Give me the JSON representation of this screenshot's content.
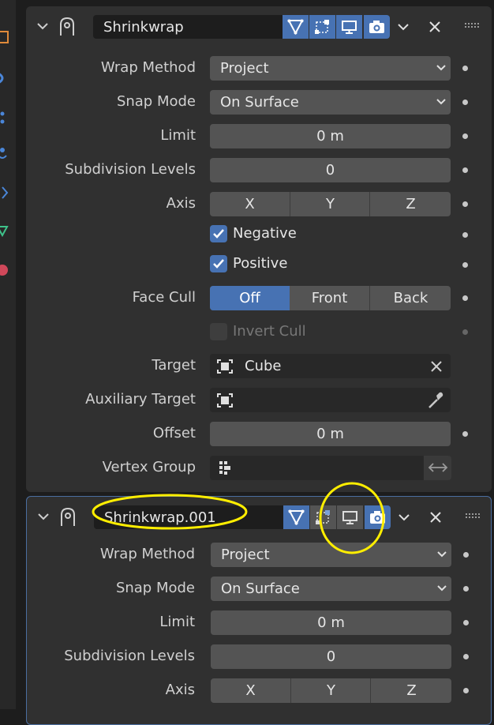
{
  "modifiers": [
    {
      "name": "Shrinkwrap",
      "toggles": [
        "edit-mode",
        "cage",
        "viewport",
        "render"
      ],
      "toggle_states": [
        true,
        true,
        true,
        true
      ],
      "props": {
        "wrap_method_label": "Wrap Method",
        "wrap_method_value": "Project",
        "snap_mode_label": "Snap Mode",
        "snap_mode_value": "On Surface",
        "limit_label": "Limit",
        "limit_value": "0 m",
        "subdiv_label": "Subdivision Levels",
        "subdiv_value": "0",
        "axis_label": "Axis",
        "axis_x": "X",
        "axis_y": "Y",
        "axis_z": "Z",
        "negative_label": "Negative",
        "positive_label": "Positive",
        "face_cull_label": "Face Cull",
        "cull_off": "Off",
        "cull_front": "Front",
        "cull_back": "Back",
        "invert_cull_label": "Invert Cull",
        "target_label": "Target",
        "target_value": "Cube",
        "aux_target_label": "Auxiliary Target",
        "aux_target_value": "",
        "offset_label": "Offset",
        "offset_value": "0 m",
        "vertex_group_label": "Vertex Group",
        "vertex_group_value": ""
      }
    },
    {
      "name": "Shrinkwrap.001",
      "toggles": [
        "edit-mode",
        "cage",
        "viewport",
        "render"
      ],
      "toggle_states": [
        true,
        false,
        false,
        true
      ],
      "props": {
        "wrap_method_label": "Wrap Method",
        "wrap_method_value": "Project",
        "snap_mode_label": "Snap Mode",
        "snap_mode_value": "On Surface",
        "limit_label": "Limit",
        "limit_value": "0 m",
        "subdiv_label": "Subdivision Levels",
        "subdiv_value": "0",
        "axis_label": "Axis",
        "axis_x": "X",
        "axis_y": "Y",
        "axis_z": "Z"
      }
    }
  ],
  "colors": {
    "accent": "#4772b3",
    "panel": "#303030",
    "field": "#545454",
    "annotation": "#ffee00"
  }
}
